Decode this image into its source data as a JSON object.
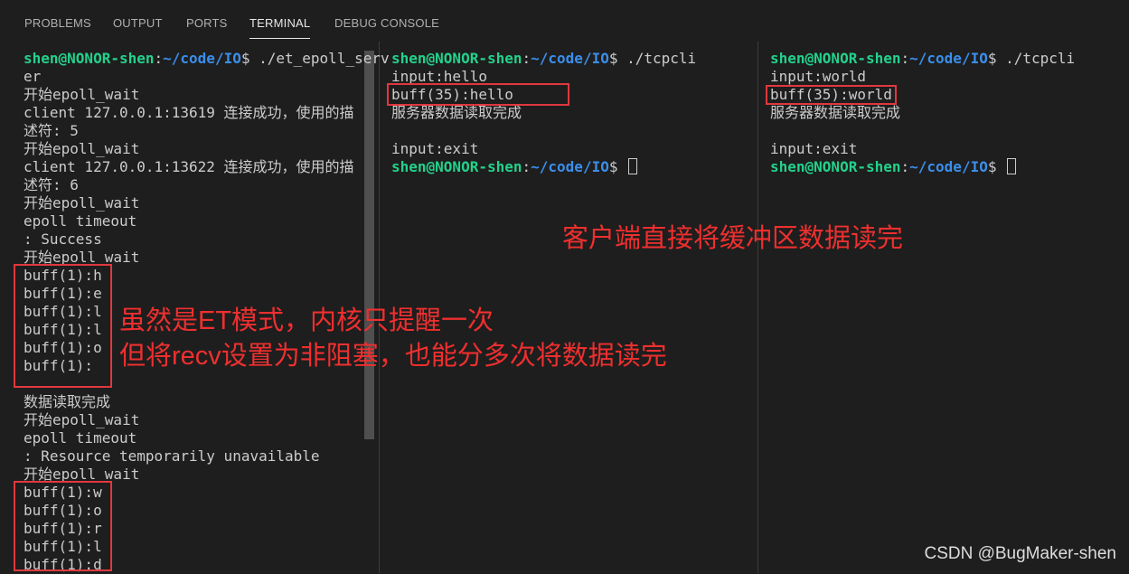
{
  "panel_tabs": [
    "PROBLEMS",
    "OUTPUT",
    "PORTS",
    "TERMINAL",
    "DEBUG CONSOLE"
  ],
  "active_tab": "TERMINAL",
  "prompt": {
    "user": "shen@NONOR-shen",
    "colon": ":",
    "path": "~/code/IO",
    "dollar": "$"
  },
  "left_terminal": {
    "command": " ./et_epoll_serv",
    "command_wrap": "er",
    "lines": [
      "开始epoll_wait",
      "client 127.0.0.1:13619 连接成功，使用的描",
      "述符: 5",
      "开始epoll_wait",
      "client 127.0.0.1:13622 连接成功，使用的描",
      "述符: 6",
      "开始epoll_wait",
      "epoll timeout",
      ": Success",
      "开始epoll_wait",
      "buff(1):h",
      "buff(1):e",
      "buff(1):l",
      "buff(1):l",
      "buff(1):o",
      "buff(1):",
      "",
      "数据读取完成",
      "开始epoll_wait",
      "epoll timeout",
      ": Resource temporarily unavailable",
      "开始epoll_wait",
      "buff(1):w",
      "buff(1):o",
      "buff(1):r",
      "buff(1):l",
      "buff(1):d"
    ]
  },
  "middle_terminal": {
    "command": " ./tcpcli",
    "lines": [
      "input:hello",
      "buff(35):hello",
      "服务器数据读取完成",
      "",
      "input:exit"
    ]
  },
  "right_terminal": {
    "command": " ./tcpcli",
    "lines": [
      "input:world",
      "buff(35):world",
      "服务器数据读取完成",
      "",
      "input:exit"
    ]
  },
  "annotations": {
    "client": "客户端直接将缓冲区数据读完",
    "server_line1": "虽然是ET模式，内核只提醒一次",
    "server_line2": "但将recv设置为非阻塞，也能分多次将数据读完"
  },
  "colors": {
    "background": "#1e1e1e",
    "prompt_user": "#23d18b",
    "prompt_path": "#3b8eea",
    "annotation_red": "#e0383e"
  },
  "watermark": "CSDN @BugMaker-shen"
}
